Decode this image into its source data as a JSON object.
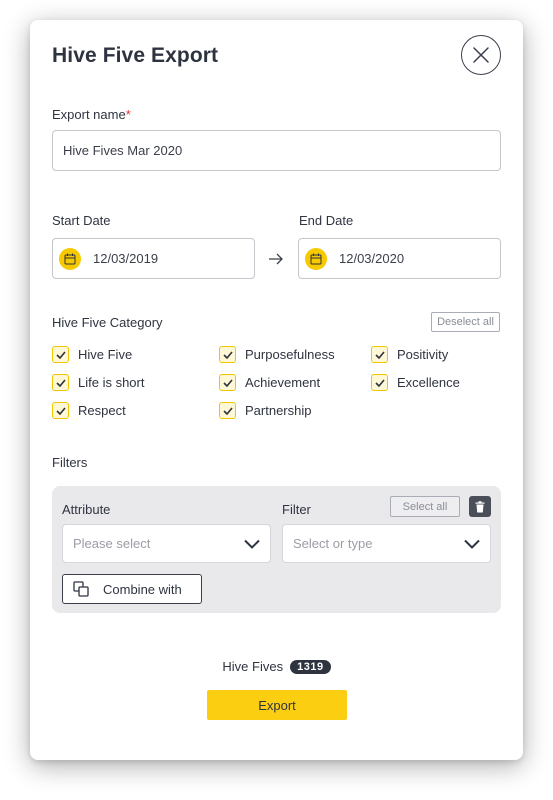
{
  "modal": {
    "title": "Hive Five Export"
  },
  "export_name": {
    "label": "Export name",
    "required_mark": "*",
    "value": "Hive Fives Mar 2020"
  },
  "dates": {
    "start_label": "Start Date",
    "start_value": "12/03/2019",
    "end_label": "End Date",
    "end_value": "12/03/2020"
  },
  "category": {
    "label": "Hive Five Category",
    "deselect_label": "Deselect all",
    "items": [
      {
        "label": "Hive Five",
        "checked": true
      },
      {
        "label": "Purposefulness",
        "checked": true
      },
      {
        "label": "Positivity",
        "checked": true
      },
      {
        "label": "Life is short",
        "checked": true
      },
      {
        "label": "Achievement",
        "checked": true
      },
      {
        "label": "Excellence",
        "checked": true
      },
      {
        "label": "Respect",
        "checked": true
      },
      {
        "label": "Partnership",
        "checked": true
      }
    ]
  },
  "filters": {
    "label": "Filters",
    "attribute_label": "Attribute",
    "filter_label": "Filter",
    "select_all_label": "Select all",
    "attribute_placeholder": "Please select",
    "filter_placeholder": "Select or type",
    "combine_label": "Combine with"
  },
  "summary": {
    "label": "Hive Fives",
    "count": "1319"
  },
  "export_button": "Export",
  "colors": {
    "accent_yellow": "#fcce12",
    "dark": "#2e3340",
    "panel_bg": "#e9e9ec"
  }
}
